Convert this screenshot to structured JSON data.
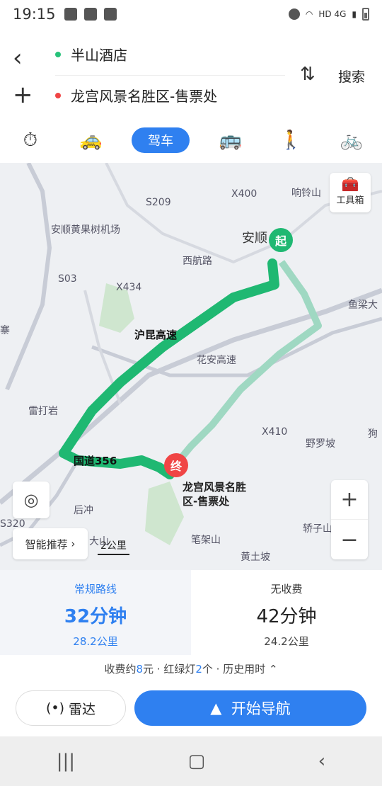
{
  "status_bar": {
    "time": "19:15",
    "network": "HD 4G"
  },
  "route": {
    "start": "半山酒店",
    "end": "龙宫风景名胜区-售票处",
    "search_label": "搜索"
  },
  "modes": {
    "active_label": "驾车",
    "icons": [
      "stopwatch-icon",
      "taxi-icon",
      "car-icon",
      "bus-icon",
      "walk-icon",
      "bike-icon"
    ]
  },
  "map": {
    "labels": {
      "x400": "X400",
      "xiangling": "响铃山",
      "s209": "S209",
      "airport": "安顺黄果树机场",
      "anshun": "安顺",
      "xihang": "西航路",
      "yuliang": "鱼梁大",
      "s03": "S03",
      "x434": "X434",
      "xihang_v": "西航路",
      "zhai": "寨",
      "huaan": "花安高速",
      "shanghai_kunming": "沪昆高速",
      "leidayan": "雷打岩",
      "x410": "X410",
      "gouqi": "狗",
      "yeluopo": "野罗坡",
      "houchong": "后冲",
      "dashan": "大山",
      "bijia": "笔架山",
      "jiaozi": "轿子山",
      "huangtupo": "黄土坡",
      "g356": "国道356",
      "x320": "S320"
    },
    "toolbox_label": "工具箱",
    "start_marker": "起",
    "end_marker": "终",
    "dest_label_line1": "龙宫风景名胜",
    "dest_label_line2": "区-售票处",
    "smart_recommend": "智能推荐",
    "scale": "2公里"
  },
  "route_options": [
    {
      "name": "常规路线",
      "time": "32分钟",
      "distance": "28.2公里"
    },
    {
      "name": "无收费",
      "time": "42分钟",
      "distance": "24.2公里"
    }
  ],
  "info": {
    "prefix": "收费约",
    "toll": "8",
    "middle": "元 · 红绿灯",
    "lights": "2",
    "suffix": "个 · 历史用时"
  },
  "actions": {
    "radar": "雷达",
    "navigate": "开始导航"
  },
  "colors": {
    "accent": "#2f80f0",
    "route_main": "#1fb872",
    "route_alt": "#9fd8c2",
    "end_red": "#f04545"
  }
}
